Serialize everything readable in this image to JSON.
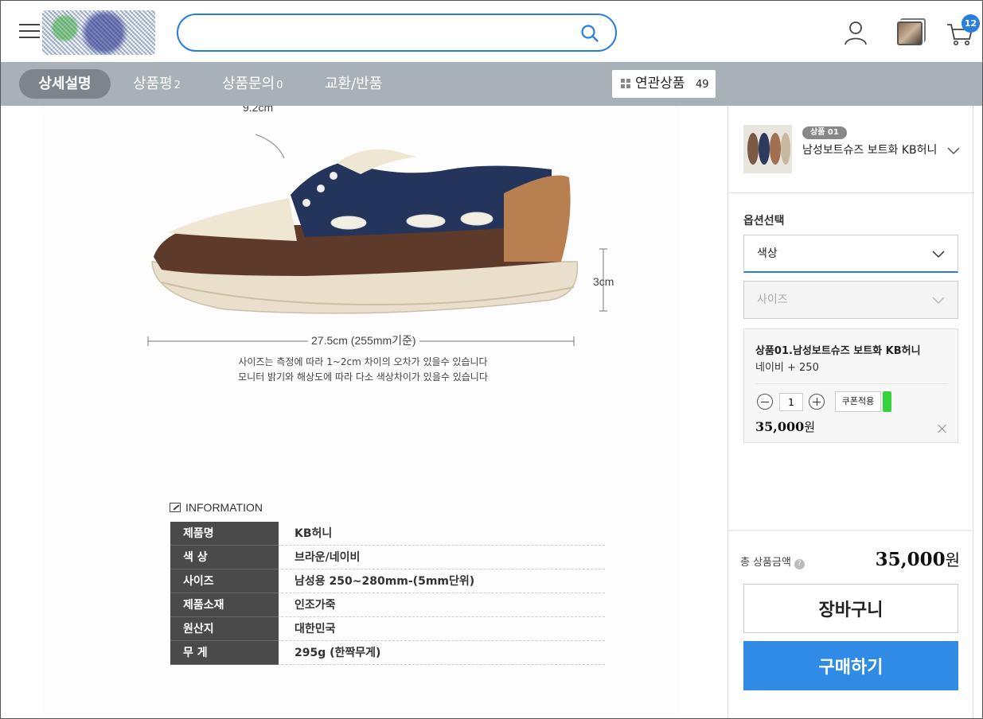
{
  "header": {
    "search_value": "",
    "cart_count": "12"
  },
  "tabs": [
    {
      "label": "상세설명",
      "count": ""
    },
    {
      "label": "상품평",
      "count": "2"
    },
    {
      "label": "상품문의",
      "count": "0"
    },
    {
      "label": "교환/반품",
      "count": ""
    }
  ],
  "related": {
    "label": "연관상품",
    "count": "49"
  },
  "detail": {
    "top_dim": "9.2cm",
    "height_dim": "3cm",
    "length_dim": "27.5cm (255mm기준)",
    "note_1": "사이즈는 측정에 따라 1~2cm 차이의 오차가 있을수 있습니다",
    "note_2": "모니터 밝기와 해상도에 따라 다소 색상차이가 있을수 있습니다",
    "info_title": "INFORMATION",
    "info_rows": [
      {
        "label": "제품명",
        "value": "KB허니"
      },
      {
        "label": "색 상",
        "value": "브라운/네이비"
      },
      {
        "label": "사이즈",
        "value": "남성용 250~280mm-(5mm단위)"
      },
      {
        "label": "제품소재",
        "value": "인조가죽"
      },
      {
        "label": "원산지",
        "value": "대한민국"
      },
      {
        "label": "무 게",
        "value": "295g (한짝무게)"
      }
    ]
  },
  "sidebar": {
    "badge": "상품 01",
    "product_name": "남성보트슈즈 보트화 KB허니",
    "option_title": "옵션선택",
    "color_select": "색상",
    "size_select": "사이즈",
    "selected": {
      "name": "상품01.남성보트슈즈 보트화 KB허니",
      "option": "네이비 + 250",
      "quantity": "1",
      "coupon": "쿠폰적용",
      "price": "35,000",
      "won": "원"
    },
    "total_label": "총 상품금액",
    "total_price": "35,000",
    "total_won": "원",
    "cart_button": "장바구니",
    "buy_button": "구매하기"
  },
  "colors": {
    "accent": "#2a7de1",
    "buy_button": "#2f8be6",
    "tab_bar": "#a9b1b8",
    "tab_active": "#7c858c"
  }
}
